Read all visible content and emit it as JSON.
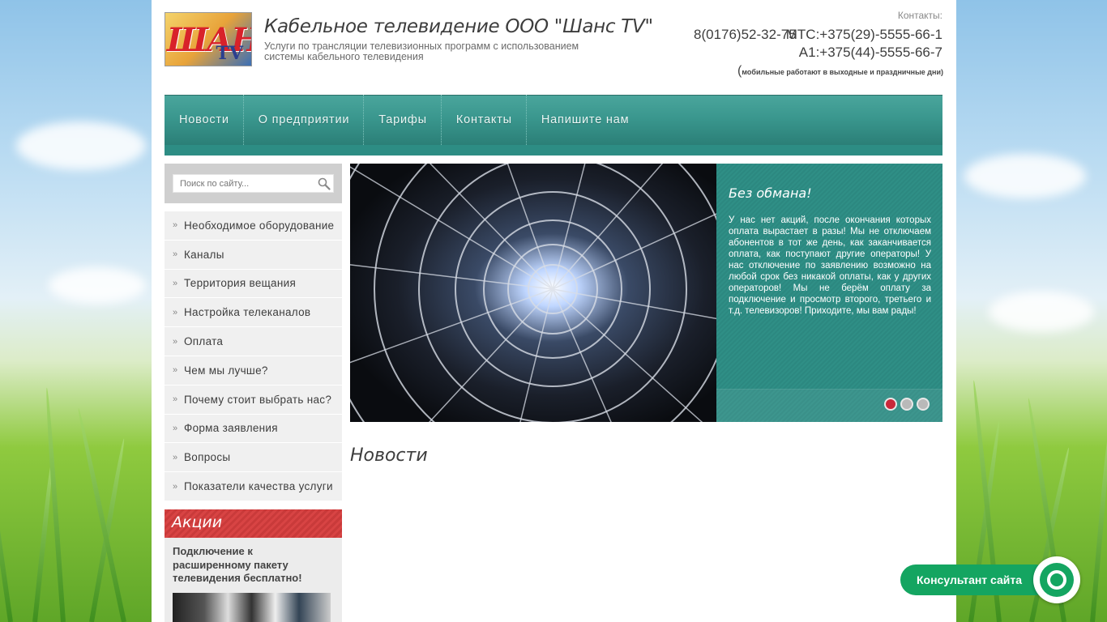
{
  "header": {
    "logo_text": "ШАНС",
    "logo_mark": "TV",
    "title": "Кабельное телевидение ООО \"Шанс TV\"",
    "subtitle": "Услуги по трансляции телевизионных программ с использованием системы кабельного телевидения",
    "contacts_label": "Контакты:",
    "phone_city": "8(0176)52-32-75",
    "phone_mts": "МТС:+375(29)-5555-66-1",
    "phone_a1": "A1:+375(44)-5555-66-7",
    "mobile_note_open": "(",
    "mobile_note": "мобильные работают в выходные и праздничные дни",
    "mobile_note_close": ")"
  },
  "nav": {
    "items": [
      {
        "label": "Новости"
      },
      {
        "label": "О предприятии"
      },
      {
        "label": "Тарифы"
      },
      {
        "label": "Контакты"
      },
      {
        "label": "Напишите нам"
      }
    ]
  },
  "search": {
    "placeholder": "Поиск по сайту..."
  },
  "sidebar": {
    "items": [
      {
        "label": "Необходимое оборудование"
      },
      {
        "label": "Каналы"
      },
      {
        "label": "Территория вещания"
      },
      {
        "label": "Настройка телеканалов"
      },
      {
        "label": "Оплата"
      },
      {
        "label": "Чем мы лучше?"
      },
      {
        "label": "Почему стоит выбрать нас?"
      },
      {
        "label": "Форма заявления"
      },
      {
        "label": "Вопросы"
      },
      {
        "label": "Показатели качества услуги"
      }
    ]
  },
  "promo": {
    "title": "Акции",
    "text": "Подключение к расширенному пакету телевидения бесплатно!"
  },
  "slider": {
    "title": "Без обмана!",
    "text": "У нас нет акций, после окончания которых оплата вырастает в разы! Мы не отключаем абонентов в тот же день, как заканчивается оплата, как поступают другие операторы! У нас отключение по заявлению возможно на любой срок без никакой оплаты, как у других операторов! Мы не берём оплату за подключение и просмотр второго, третьего и т.д. телевизоров! Приходите, мы вам рады!",
    "dots": 3,
    "active_dot": 1
  },
  "main": {
    "news_heading": "Новости"
  },
  "consultant": {
    "label": "Консультант сайта"
  },
  "colors": {
    "teal": "#2f8f86",
    "promo_red": "#d84444",
    "consultant_green": "#14a561",
    "active_dot": "#c8283a"
  }
}
